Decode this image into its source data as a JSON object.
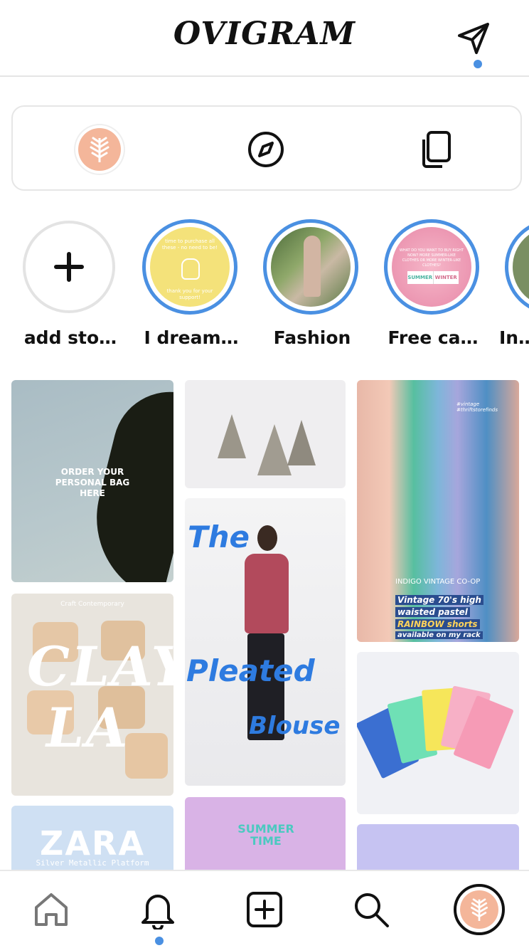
{
  "header": {
    "logo": "OVIGRAM",
    "send_icon": "send-icon",
    "accent_color": "#4a90e2"
  },
  "switcher": {
    "items": [
      {
        "name": "profile-avatar",
        "icon": "leaf-avatar"
      },
      {
        "name": "explore",
        "icon": "compass-icon"
      },
      {
        "name": "collections",
        "icon": "copy-icon"
      }
    ]
  },
  "stories": [
    {
      "label": "add sto…",
      "type": "add"
    },
    {
      "label": "I dream…",
      "type": "story"
    },
    {
      "label": "Fashion",
      "type": "story"
    },
    {
      "label": "Free ca…",
      "type": "story"
    },
    {
      "label": "In…",
      "type": "story"
    }
  ],
  "story_texts": {
    "dream_top": "time to purchase all these - no need to be!",
    "dream_bottom": "thank you for your support!",
    "free_top": "WHAT DO YOU WANT TO BUY RIGHT NOW? MORE SUMMER-LIKE CLOTHES OR MORE WINTER-LIKE CLOTHES?",
    "summer": "SUMMER",
    "winter": "WINTER"
  },
  "feed": {
    "bag_text": "ORDER YOUR PERSONAL BAG HERE",
    "clay_caption": "Craft Contemporary",
    "clay_title": "CLAY LA",
    "blouse_the": "The",
    "blouse_pleated": "Pleated",
    "blouse_blouse": "Blouse",
    "vintage_tags": "#vintage #thriftstorefinds",
    "vintage_location": "INDIGO VINTAGE CO-OP",
    "vintage_line1": "Vintage 70's high",
    "vintage_line2": "waisted pastel",
    "vintage_line3": "RAINBOW shorts",
    "vintage_line4": "available on my rack",
    "zara_title": "ZARA",
    "zara_sub": "Silver Metallic Platform",
    "summer_time": "SUMMER TIME"
  },
  "bottom_nav": [
    {
      "name": "home",
      "icon": "home-icon"
    },
    {
      "name": "notifications",
      "icon": "bell-icon"
    },
    {
      "name": "create",
      "icon": "plus-square-icon"
    },
    {
      "name": "search",
      "icon": "search-icon"
    },
    {
      "name": "profile",
      "icon": "leaf-avatar"
    }
  ]
}
